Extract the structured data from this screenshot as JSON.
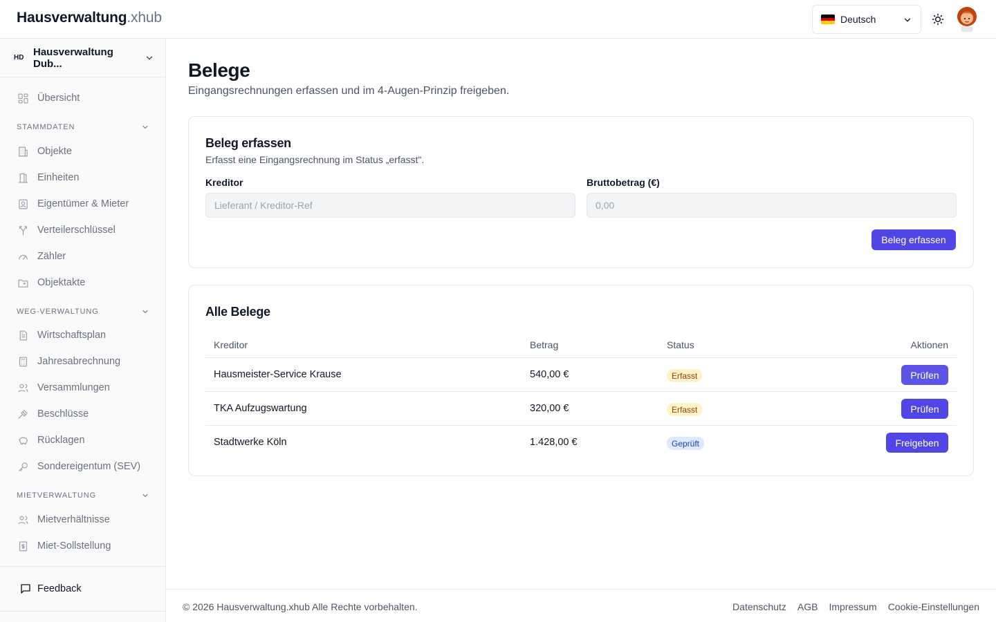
{
  "header": {
    "brand_bold": "Hausverwaltung",
    "brand_light": ".xhub",
    "language": "Deutsch",
    "flag_colors": [
      "#000000",
      "#dd0000",
      "#ffce00"
    ]
  },
  "sidebar": {
    "org_badge": "HD",
    "org_name": "Hausverwaltung Dub...",
    "overview": "Übersicht",
    "sections": [
      {
        "title": "STAMMDATEN",
        "items": [
          "Objekte",
          "Einheiten",
          "Eigentümer & Mieter",
          "Verteilerschlüssel",
          "Zähler",
          "Objektakte"
        ]
      },
      {
        "title": "WEG-VERWALTUNG",
        "items": [
          "Wirtschaftsplan",
          "Jahresabrechnung",
          "Versammlungen",
          "Beschlüsse",
          "Rücklagen",
          "Sondereigentum (SEV)"
        ]
      },
      {
        "title": "MIETVERWALTUNG",
        "items": [
          "Mietverhältnisse",
          "Miet-Sollstellung"
        ]
      }
    ],
    "feedback": "Feedback"
  },
  "page": {
    "title": "Belege",
    "subtitle": "Eingangsrechnungen erfassen und im 4-Augen-Prinzip freigeben."
  },
  "form": {
    "title": "Beleg erfassen",
    "description": "Erfasst eine Eingangsrechnung im Status „erfasst\".",
    "kreditor_label": "Kreditor",
    "kreditor_placeholder": "Lieferant / Kreditor-Ref",
    "kreditor_value": "",
    "betrag_label": "Bruttobetrag (€)",
    "betrag_placeholder": "0,00",
    "betrag_value": "",
    "submit": "Beleg erfassen"
  },
  "list": {
    "title": "Alle Belege",
    "columns": [
      "Kreditor",
      "Betrag",
      "Status",
      "Aktionen"
    ],
    "rows": [
      {
        "kreditor": "Hausmeister-Service Krause",
        "betrag": "540,00 €",
        "status": "Erfasst",
        "action": "Prüfen"
      },
      {
        "kreditor": "TKA Aufzugswartung",
        "betrag": "320,00 €",
        "status": "Erfasst",
        "action": "Prüfen"
      },
      {
        "kreditor": "Stadtwerke Köln",
        "betrag": "1.428,00 €",
        "status": "Geprüft",
        "action": "Freigeben"
      }
    ]
  },
  "footer": {
    "copyright": "© 2026 Hausverwaltung.xhub Alle Rechte vorbehalten.",
    "links": [
      "Datenschutz",
      "AGB",
      "Impressum",
      "Cookie-Einstellungen"
    ]
  },
  "colors": {
    "primary": "#4f46e5",
    "badge_erfasst_bg": "#fef3c7",
    "badge_geprueft_bg": "#dbeafe"
  }
}
